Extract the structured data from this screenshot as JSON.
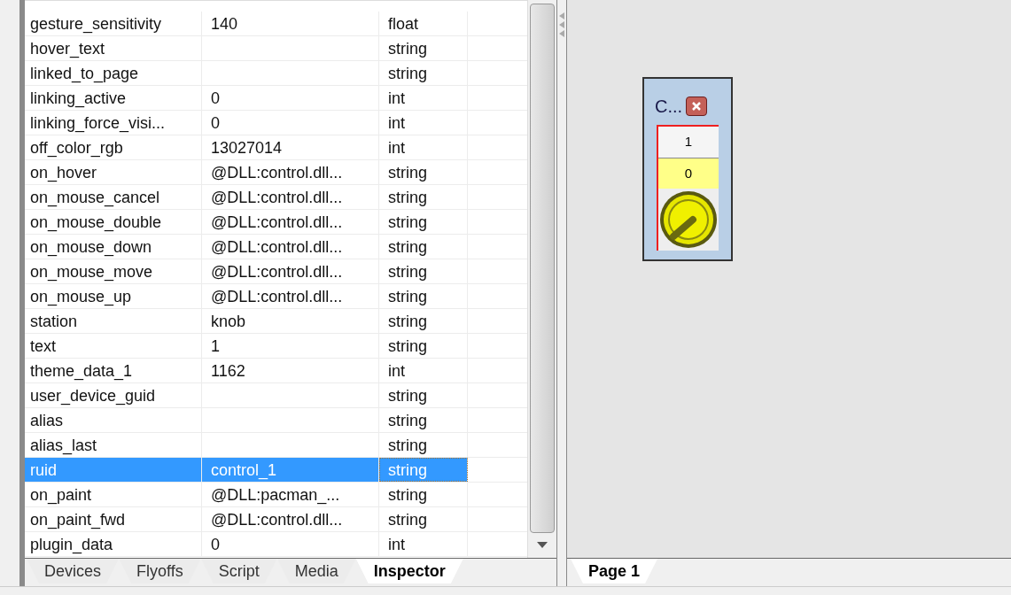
{
  "properties": [
    {
      "name": "gesture_sensitivity",
      "value": "140",
      "type": "float",
      "selected": false
    },
    {
      "name": "hover_text",
      "type": "string",
      "selected": false
    },
    {
      "name": "linked_to_page",
      "type": "string",
      "selected": false
    },
    {
      "name": "linking_active",
      "value": "0",
      "type": "int",
      "selected": false
    },
    {
      "name": "linking_force_visi...",
      "value": "0",
      "type": "int",
      "selected": false
    },
    {
      "name": "off_color_rgb",
      "value": "13027014",
      "type": "int",
      "selected": false
    },
    {
      "name": "on_hover",
      "value": "@DLL:control.dll...",
      "type": "string",
      "selected": false
    },
    {
      "name": "on_mouse_cancel",
      "value": "@DLL:control.dll...",
      "type": "string",
      "selected": false
    },
    {
      "name": "on_mouse_double",
      "value": "@DLL:control.dll...",
      "type": "string",
      "selected": false
    },
    {
      "name": "on_mouse_down",
      "value": "@DLL:control.dll...",
      "type": "string",
      "selected": false
    },
    {
      "name": "on_mouse_move",
      "value": "@DLL:control.dll...",
      "type": "string",
      "selected": false
    },
    {
      "name": "on_mouse_up",
      "value": "@DLL:control.dll...",
      "type": "string",
      "selected": false
    },
    {
      "name": "station",
      "value": "knob",
      "type": "string",
      "selected": false
    },
    {
      "name": "text",
      "value": "1",
      "type": "string",
      "selected": false
    },
    {
      "name": "theme_data_1",
      "value": "1162",
      "type": "int",
      "selected": false
    },
    {
      "name": "user_device_guid",
      "type": "string",
      "selected": false
    },
    {
      "name": "alias",
      "type": "string",
      "selected": false
    },
    {
      "name": "alias_last",
      "type": "string",
      "selected": false
    },
    {
      "name": "ruid",
      "value": "control_1",
      "type": "string",
      "selected": true
    },
    {
      "name": "on_paint",
      "value": "@DLL:pacman_...",
      "type": "string",
      "selected": false
    },
    {
      "name": "on_paint_fwd",
      "value": "@DLL:control.dll...",
      "type": "string",
      "selected": false
    },
    {
      "name": "plugin_data",
      "value": "0",
      "type": "int",
      "selected": false
    }
  ],
  "panel_tabs": [
    {
      "label": "Devices",
      "selected": false
    },
    {
      "label": "Flyoffs",
      "selected": false
    },
    {
      "label": "Script",
      "selected": false
    },
    {
      "label": "Media",
      "selected": false
    },
    {
      "label": "Inspector",
      "selected": true
    }
  ],
  "widget": {
    "title": "C...",
    "text": "1",
    "value": "0"
  },
  "page_tabs": [
    {
      "label": "Page 1",
      "selected": true
    }
  ]
}
